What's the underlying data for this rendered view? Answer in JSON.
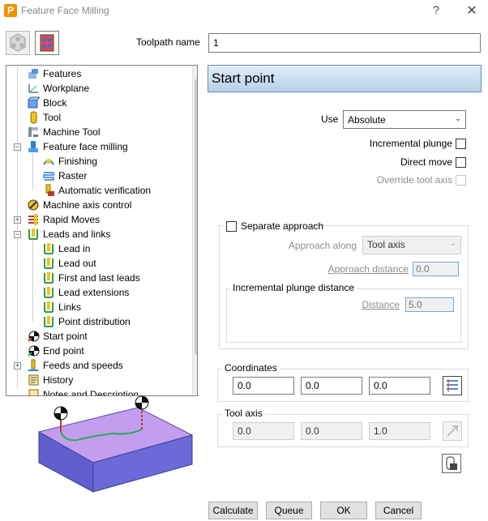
{
  "window": {
    "title": "Feature Face Milling",
    "help": "?",
    "close": "✕",
    "logo": "P"
  },
  "toolpath_name": {
    "label": "Toolpath name",
    "value": "1"
  },
  "tree": {
    "items": [
      {
        "label": "Features"
      },
      {
        "label": "Workplane"
      },
      {
        "label": "Block"
      },
      {
        "label": "Tool"
      },
      {
        "label": "Machine Tool"
      },
      {
        "label": "Feature face milling"
      },
      {
        "label": "Finishing"
      },
      {
        "label": "Raster"
      },
      {
        "label": "Automatic verification"
      },
      {
        "label": "Machine axis control"
      },
      {
        "label": "Rapid Moves"
      },
      {
        "label": "Leads and links"
      },
      {
        "label": "Lead in"
      },
      {
        "label": "Lead out"
      },
      {
        "label": "First and last leads"
      },
      {
        "label": "Lead extensions"
      },
      {
        "label": "Links"
      },
      {
        "label": "Point distribution"
      },
      {
        "label": "Start point"
      },
      {
        "label": "End point"
      },
      {
        "label": "Feeds and speeds"
      },
      {
        "label": "History"
      },
      {
        "label": "Notes and Description"
      }
    ]
  },
  "page": {
    "header": "Start point"
  },
  "use": {
    "label": "Use",
    "value": "Absolute"
  },
  "options": {
    "incremental_plunge": "Incremental plunge",
    "direct_move": "Direct move",
    "override_tool_axis": "Override tool axis"
  },
  "separate_approach": {
    "label": "Separate approach",
    "approach_along_label": "Approach along",
    "approach_along_value": "Tool axis",
    "approach_distance_label": "Approach distance",
    "approach_distance_value": "0.0",
    "incremental_plunge_title": "Incremental plunge distance",
    "distance_label": "Distance",
    "distance_value": "5.0"
  },
  "coordinates": {
    "label": "Coordinates",
    "x": "0.0",
    "y": "0.0",
    "z": "0.0"
  },
  "tool_axis": {
    "label": "Tool axis",
    "i": "0.0",
    "j": "0.0",
    "k": "1.0"
  },
  "buttons": {
    "calculate": "Calculate",
    "queue": "Queue",
    "ok": "OK",
    "cancel": "Cancel"
  },
  "colors": {
    "header_top": "#e0edf8",
    "header_bottom": "#b8d0e8",
    "block_top": "#c39ef0",
    "block_side": "#6a6ad8"
  }
}
